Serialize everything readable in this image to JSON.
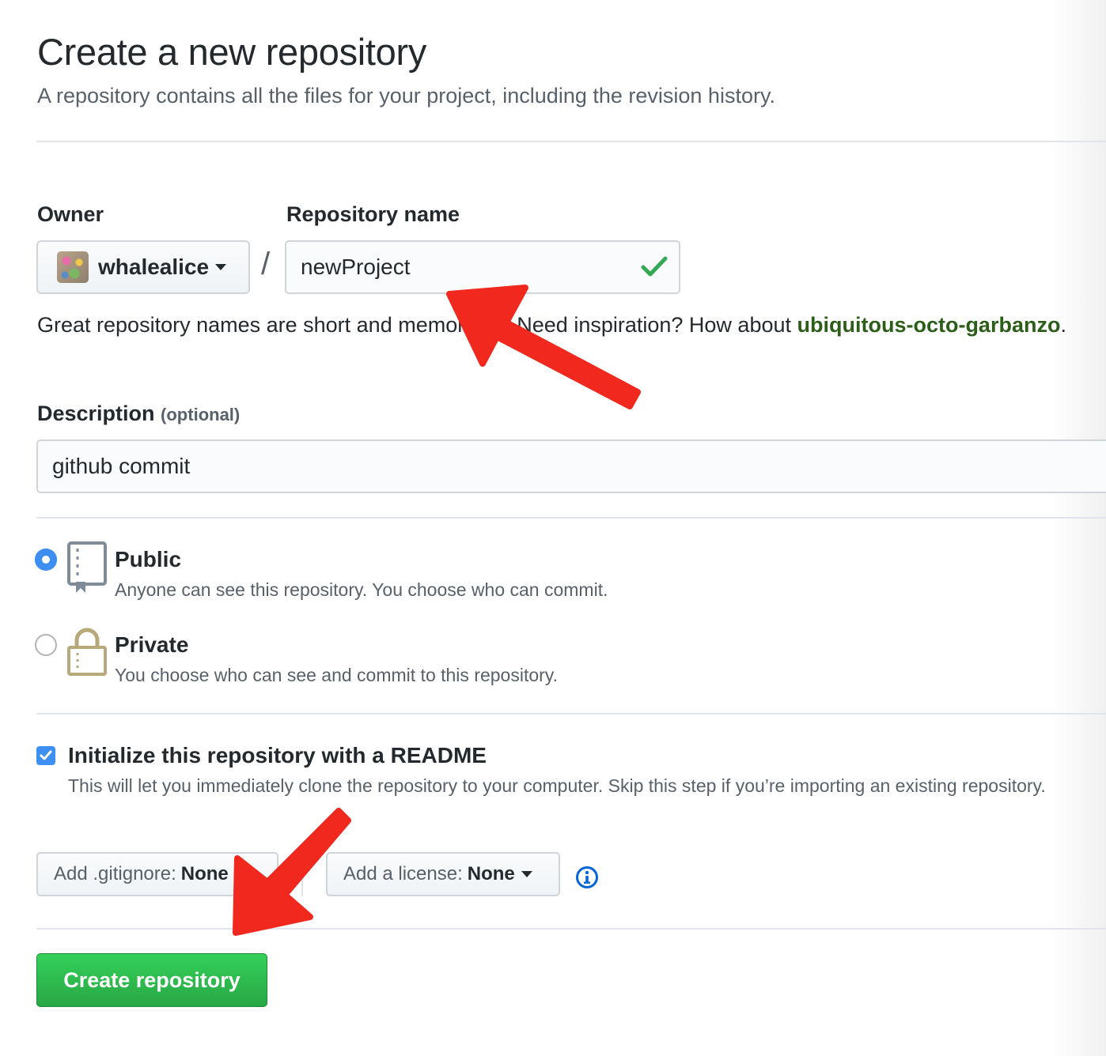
{
  "header": {
    "title": "Create a new repository",
    "subtitle": "A repository contains all the files for your project, including the revision history."
  },
  "owner": {
    "label": "Owner",
    "name": "whalealice"
  },
  "separator": "/",
  "repo_name": {
    "label": "Repository name",
    "value": "newProject",
    "status_icon": "check-icon"
  },
  "hint": {
    "text": "Great repository names are short and memorable. Need inspiration? How about ",
    "suggestion": "ubiquitous-octo-garbanzo",
    "end": "."
  },
  "description": {
    "label": "Description",
    "optional": "(optional)",
    "value": "github commit"
  },
  "visibility": {
    "options": [
      {
        "title": "Public",
        "desc": "Anyone can see this repository. You choose who can commit.",
        "icon": "repo-book-icon",
        "selected": true
      },
      {
        "title": "Private",
        "desc": "You choose who can see and commit to this repository.",
        "icon": "lock-icon",
        "selected": false
      }
    ]
  },
  "readme": {
    "checked": true,
    "title": "Initialize this repository with a README",
    "desc": "This will let you immediately clone the repository to your computer. Skip this step if you’re importing an existing repository."
  },
  "gitignore": {
    "label": "Add .gitignore:",
    "value": "None"
  },
  "license": {
    "label": "Add a license:",
    "value": "None"
  },
  "info_icon": "info-icon",
  "submit": {
    "label": "Create repository"
  },
  "colors": {
    "primary_green": "#28a745",
    "suggestion_green": "#2c5e1a",
    "radio_blue": "#3d8ff2",
    "annotation_red": "#f0281e",
    "icon_gold": "#b8a97a"
  }
}
